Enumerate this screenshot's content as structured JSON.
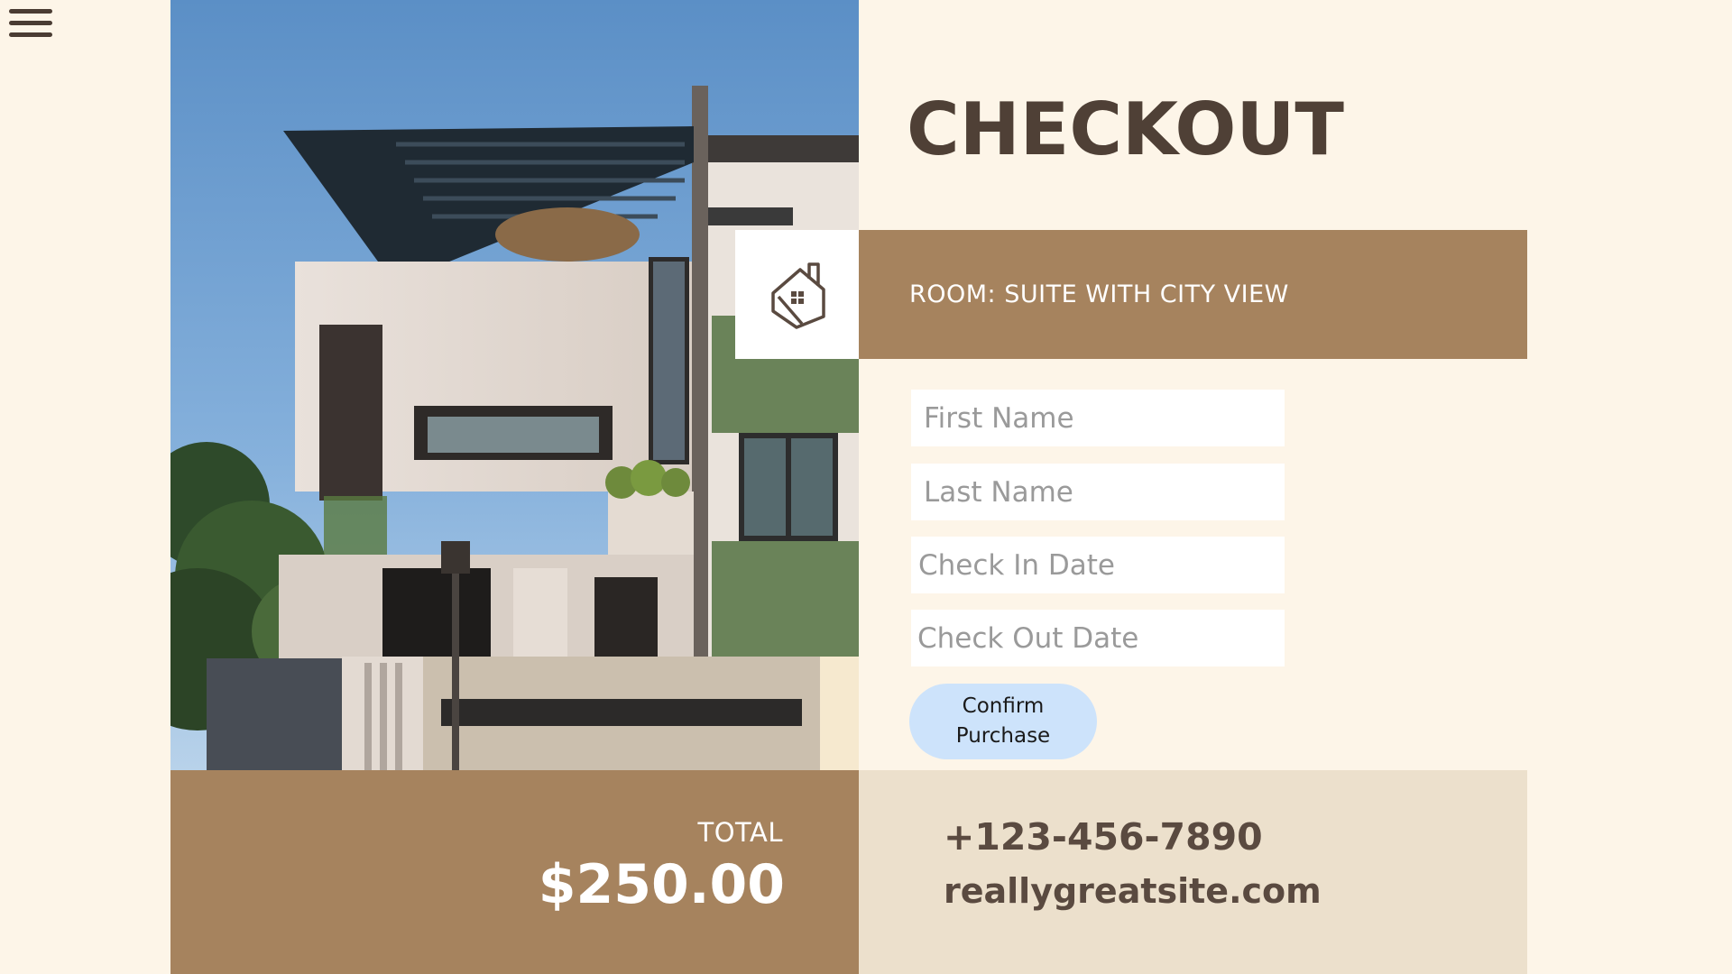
{
  "header": {
    "title": "CHECKOUT",
    "menu_icon": "hamburger-menu-icon"
  },
  "room": {
    "label": "ROOM: SUITE WITH CITY VIEW",
    "logo_icon": "house-logo-icon"
  },
  "form": {
    "first_name_placeholder": "First Name",
    "last_name_placeholder": "Last Name",
    "check_in_placeholder": "Check In Date",
    "check_out_placeholder": "Check Out Date",
    "confirm_label": "Confirm Purchase"
  },
  "summary": {
    "total_label": "TOTAL",
    "total_value": "$250.00"
  },
  "contact": {
    "phone": "+123-456-7890",
    "website": "reallygreatsite.com"
  },
  "colors": {
    "background": "#fdf5e8",
    "accent_brown": "#a6835e",
    "dark_text": "#4f4036",
    "contact_band": "#ece0cc",
    "button": "#cde3fb"
  }
}
